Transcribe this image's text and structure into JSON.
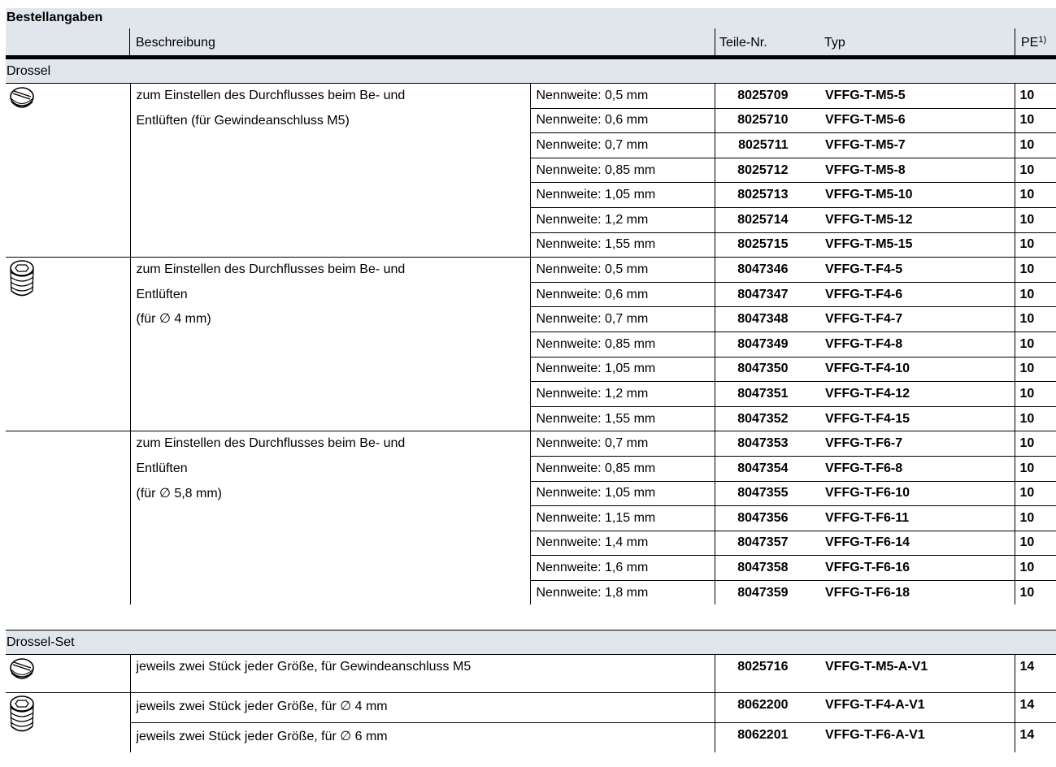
{
  "title": "Bestellangaben",
  "headers": {
    "beschreibung": "Beschreibung",
    "teilenr": "Teile-Nr.",
    "typ": "Typ",
    "pe": "PE",
    "pe_sup": "1)"
  },
  "sections": [
    {
      "name": "Drossel",
      "groups": [
        {
          "icon": "throttle-screw-slotted-icon",
          "description": [
            "zum Einstellen des Durchflusses beim Be- und",
            "Entlüften (für Gewindeanschluss M5)"
          ],
          "rows": [
            {
              "nennweite": "Nennweite: 0,5 mm",
              "teilenr": "8025709",
              "typ": "VFFG-T-M5-5",
              "pe": "10"
            },
            {
              "nennweite": "Nennweite: 0,6 mm",
              "teilenr": "8025710",
              "typ": "VFFG-T-M5-6",
              "pe": "10"
            },
            {
              "nennweite": "Nennweite: 0,7 mm",
              "teilenr": "8025711",
              "typ": "VFFG-T-M5-7",
              "pe": "10"
            },
            {
              "nennweite": "Nennweite: 0,85 mm",
              "teilenr": "8025712",
              "typ": "VFFG-T-M5-8",
              "pe": "10"
            },
            {
              "nennweite": "Nennweite: 1,05 mm",
              "teilenr": "8025713",
              "typ": "VFFG-T-M5-10",
              "pe": "10"
            },
            {
              "nennweite": "Nennweite: 1,2 mm",
              "teilenr": "8025714",
              "typ": "VFFG-T-M5-12",
              "pe": "10"
            },
            {
              "nennweite": "Nennweite: 1,55 mm",
              "teilenr": "8025715",
              "typ": "VFFG-T-M5-15",
              "pe": "10"
            }
          ]
        },
        {
          "icon": "throttle-hex-insert-icon",
          "description": [
            "zum Einstellen des Durchflusses beim Be- und",
            "Entlüften",
            "(für ∅  4 mm)"
          ],
          "rows": [
            {
              "nennweite": "Nennweite: 0,5 mm",
              "teilenr": "8047346",
              "typ": "VFFG-T-F4-5",
              "pe": "10"
            },
            {
              "nennweite": "Nennweite: 0,6 mm",
              "teilenr": "8047347",
              "typ": "VFFG-T-F4-6",
              "pe": "10"
            },
            {
              "nennweite": "Nennweite: 0,7 mm",
              "teilenr": "8047348",
              "typ": "VFFG-T-F4-7",
              "pe": "10"
            },
            {
              "nennweite": "Nennweite: 0,85 mm",
              "teilenr": "8047349",
              "typ": "VFFG-T-F4-8",
              "pe": "10"
            },
            {
              "nennweite": "Nennweite: 1,05 mm",
              "teilenr": "8047350",
              "typ": "VFFG-T-F4-10",
              "pe": "10"
            },
            {
              "nennweite": "Nennweite: 1,2 mm",
              "teilenr": "8047351",
              "typ": "VFFG-T-F4-12",
              "pe": "10"
            },
            {
              "nennweite": "Nennweite: 1,55 mm",
              "teilenr": "8047352",
              "typ": "VFFG-T-F4-15",
              "pe": "10"
            }
          ]
        },
        {
          "icon": "",
          "description": [
            "zum Einstellen des Durchflusses beim Be- und",
            "Entlüften",
            "(für ∅ 5,8 mm)"
          ],
          "rows": [
            {
              "nennweite": "Nennweite: 0,7 mm",
              "teilenr": "8047353",
              "typ": "VFFG-T-F6-7",
              "pe": "10"
            },
            {
              "nennweite": "Nennweite: 0,85 mm",
              "teilenr": "8047354",
              "typ": "VFFG-T-F6-8",
              "pe": "10"
            },
            {
              "nennweite": "Nennweite: 1,05 mm",
              "teilenr": "8047355",
              "typ": "VFFG-T-F6-10",
              "pe": "10"
            },
            {
              "nennweite": "Nennweite: 1,15 mm",
              "teilenr": "8047356",
              "typ": "VFFG-T-F6-11",
              "pe": "10"
            },
            {
              "nennweite": "Nennweite: 1,4 mm",
              "teilenr": "8047357",
              "typ": "VFFG-T-F6-14",
              "pe": "10"
            },
            {
              "nennweite": "Nennweite: 1,6 mm",
              "teilenr": "8047358",
              "typ": "VFFG-T-F6-16",
              "pe": "10"
            },
            {
              "nennweite": "Nennweite: 1,8 mm",
              "teilenr": "8047359",
              "typ": "VFFG-T-F6-18",
              "pe": "10"
            }
          ]
        }
      ]
    },
    {
      "name": "Drossel-Set",
      "rows": [
        {
          "description": "jeweils zwei Stück jeder Größe, für Gewindeanschluss M5",
          "teilenr": "8025716",
          "typ": "VFFG-T-M5-A-V1",
          "pe": "14"
        },
        {
          "description": "jeweils zwei Stück jeder Größe, für ∅ 4 mm",
          "teilenr": "8062200",
          "typ": "VFFG-T-F4-A-V1",
          "pe": "14"
        },
        {
          "description": "jeweils zwei Stück jeder Größe, für ∅ 6 mm",
          "teilenr": "8062201",
          "typ": "VFFG-T-F6-A-V1",
          "pe": "14"
        }
      ]
    }
  ],
  "colors": {
    "header_bg": "#e0e6ec",
    "rule": "#000000"
  }
}
